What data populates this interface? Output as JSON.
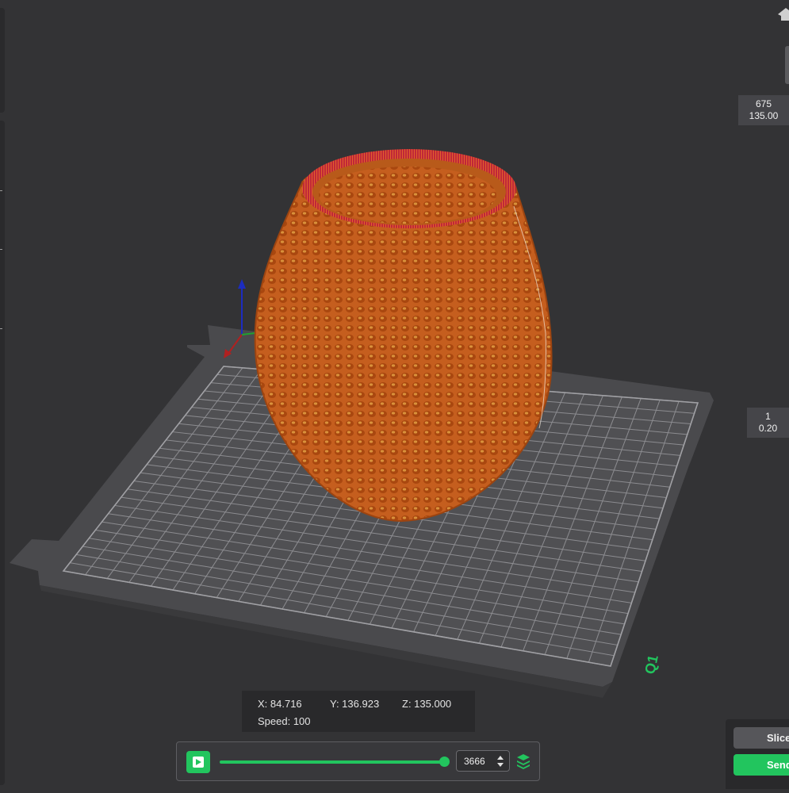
{
  "layer_slider": {
    "top": {
      "layer": "675",
      "height": "135.00"
    },
    "bottom": {
      "layer": "1",
      "height": "0.20"
    }
  },
  "position_info": {
    "x": "X: 84.716",
    "y": "Y: 136.923",
    "z": "Z: 135.000",
    "speed": "Speed: 100"
  },
  "playback": {
    "move_value": "3666",
    "progress": 1.0
  },
  "actions": {
    "slice_label": "Slice",
    "send_label": "Send"
  },
  "plate_logo": "Q1",
  "colors": {
    "accent": "#22c55e",
    "model_wall": "#c8601c",
    "model_rim": "#c02838",
    "background": "#333335"
  },
  "icons": [
    "home-icon",
    "play-icon",
    "layers-icon",
    "stepper-arrows-icon"
  ]
}
